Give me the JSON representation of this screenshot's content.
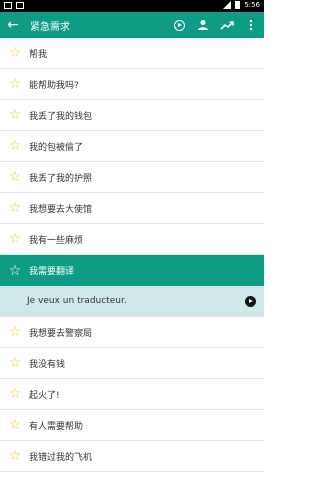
{
  "status_bar": {
    "time": "5:56"
  },
  "app_bar": {
    "title": "紧急需求",
    "back_icon": "back-arrow-icon",
    "actions": [
      "play-circle-icon",
      "person-icon",
      "trending-up-icon",
      "more-vertical-icon"
    ]
  },
  "items": [
    {
      "label": "帮我"
    },
    {
      "label": "能帮助我吗?"
    },
    {
      "label": "我丢了我的钱包"
    },
    {
      "label": "我的包被偷了"
    },
    {
      "label": "我丢了我的护照"
    },
    {
      "label": "我想要去大使馆"
    },
    {
      "label": "我有一些麻烦"
    },
    {
      "label": "我需要翻译"
    },
    {
      "label": "我想要去警察局"
    },
    {
      "label": "我没有钱"
    },
    {
      "label": "起火了!"
    },
    {
      "label": "有人需要帮助"
    },
    {
      "label": "我错过我的飞机"
    }
  ],
  "selected": {
    "translation": "Je veux un traducteur."
  },
  "colors": {
    "accent": "#0f9c86",
    "translation_bg": "#cfe9eb",
    "star": "#f4c430"
  }
}
